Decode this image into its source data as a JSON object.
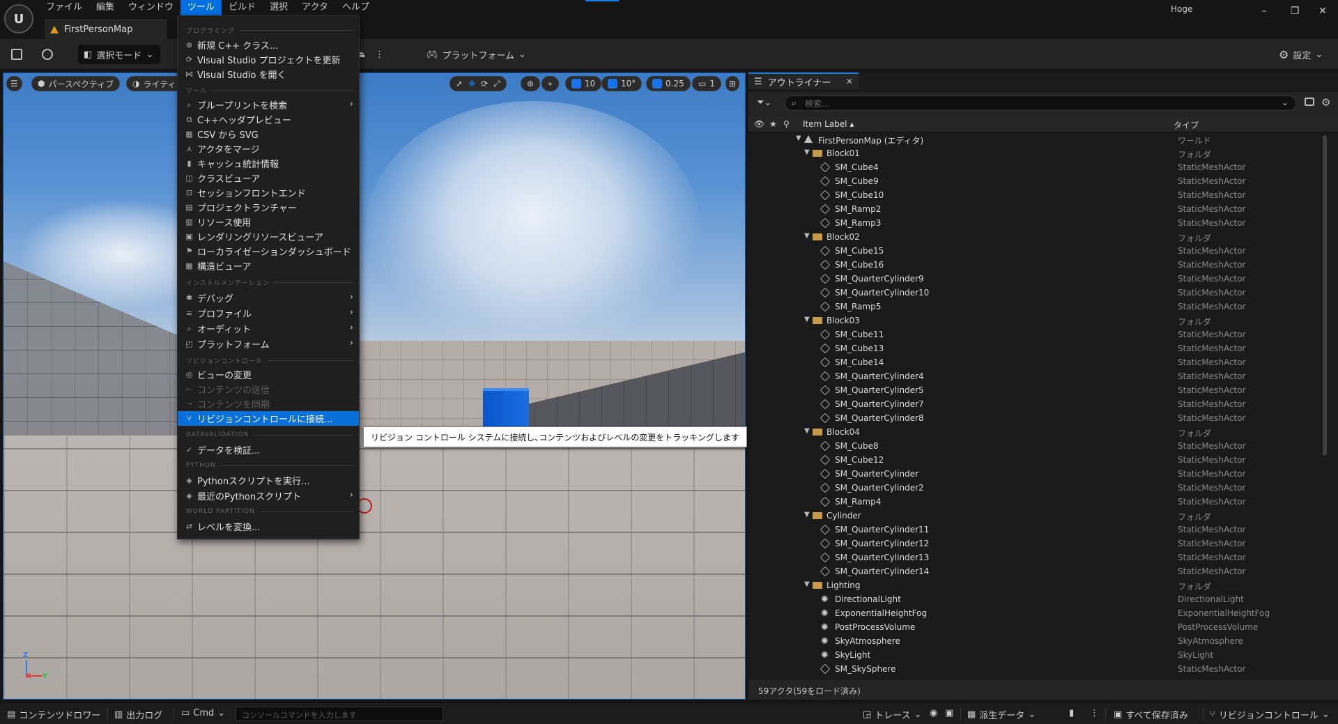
{
  "menubar": {
    "items": [
      "ファイル",
      "編集",
      "ウィンドウ",
      "ツール",
      "ビルド",
      "選択",
      "アクタ",
      "ヘルプ"
    ],
    "active_index": 3
  },
  "level_tab": "FirstPersonMap",
  "user_name": "Hoge",
  "toolbar": {
    "mode_label": "選択モード",
    "platform_label": "プラットフォーム",
    "settings_label": "設定"
  },
  "viewport": {
    "perspective_label": "パースペクティブ",
    "lighting_label": "ライティ",
    "grid_size": "10",
    "rotation_snap": "10°",
    "scale_snap": "0.25",
    "camera_speed": "1",
    "axis_labels": {
      "x": "X",
      "y": "Y",
      "z": "Z"
    },
    "accent_color": "#1a73e8"
  },
  "tools_menu": {
    "sections": {
      "programming": "プログラミング",
      "tools": "ツール",
      "instrumentation": "インストルメンテーション",
      "revision": "リビジョンコントロール",
      "datavalidation": "DATAVALIDATION",
      "python": "PYTHON",
      "world_partition": "WORLD PARTITION"
    },
    "items": {
      "new_cpp_class": "新規 C++ クラス...",
      "refresh_vs": "Visual Studio プロジェクトを更新",
      "open_vs": "Visual Studio を開く",
      "find_blueprint": "ブループリントを検索",
      "cpp_header_preview": "C++ヘッダプレビュー",
      "csv_to_svg": "CSV から SVG",
      "merge_actors": "アクタをマージ",
      "cache_stats": "キャッシュ統計情報",
      "class_viewer": "クラスビューア",
      "session_frontend": "セッションフロントエンド",
      "project_launcher": "プロジェクトランチャー",
      "resource_usage": "リソース使用",
      "render_resource_viewer": "レンダリングリソースビューア",
      "localization_dashboard": "ローカライゼーションダッシュボード",
      "struct_viewer": "構造ビューア",
      "debug": "デバッグ",
      "profile": "プロファイル",
      "audit": "オーディット",
      "platform": "プラットフォーム",
      "view_changes": "ビューの変更",
      "submit_content": "コンテンツの送信",
      "sync_content": "コンテンツを同期",
      "connect_revision": "リビジョンコントロールに接続...",
      "validate_data": "データを検証...",
      "run_python": "Pythonスクリプトを実行...",
      "recent_python": "最近のPythonスクリプト",
      "convert_level": "レベルを変換..."
    }
  },
  "tooltip": "リビジョン コントロール システムに接続し､コンテンツおよびレベルの変更をトラッキングします",
  "outliner": {
    "tab_title": "アウトライナー",
    "search_placeholder": "検索...",
    "col_label": "Item Label ▴",
    "col_type": "タイプ",
    "footer": "59アクタ(59をロード済み)",
    "rows": [
      {
        "label": "FirstPersonMap (エディタ)",
        "type": "ワールド",
        "kind": "world",
        "depth": 0
      },
      {
        "label": "Block01",
        "type": "フォルダ",
        "kind": "folder",
        "depth": 1
      },
      {
        "label": "SM_Cube4",
        "type": "StaticMeshActor",
        "kind": "mesh",
        "depth": 2
      },
      {
        "label": "SM_Cube9",
        "type": "StaticMeshActor",
        "kind": "mesh",
        "depth": 2
      },
      {
        "label": "SM_Cube10",
        "type": "StaticMeshActor",
        "kind": "mesh",
        "depth": 2
      },
      {
        "label": "SM_Ramp2",
        "type": "StaticMeshActor",
        "kind": "mesh",
        "depth": 2
      },
      {
        "label": "SM_Ramp3",
        "type": "StaticMeshActor",
        "kind": "mesh",
        "depth": 2
      },
      {
        "label": "Block02",
        "type": "フォルダ",
        "kind": "folder",
        "depth": 1
      },
      {
        "label": "SM_Cube15",
        "type": "StaticMeshActor",
        "kind": "mesh",
        "depth": 2
      },
      {
        "label": "SM_Cube16",
        "type": "StaticMeshActor",
        "kind": "mesh",
        "depth": 2
      },
      {
        "label": "SM_QuarterCylinder9",
        "type": "StaticMeshActor",
        "kind": "mesh",
        "depth": 2
      },
      {
        "label": "SM_QuarterCylinder10",
        "type": "StaticMeshActor",
        "kind": "mesh",
        "depth": 2
      },
      {
        "label": "SM_Ramp5",
        "type": "StaticMeshActor",
        "kind": "mesh",
        "depth": 2
      },
      {
        "label": "Block03",
        "type": "フォルダ",
        "kind": "folder",
        "depth": 1
      },
      {
        "label": "SM_Cube11",
        "type": "StaticMeshActor",
        "kind": "mesh",
        "depth": 2
      },
      {
        "label": "SM_Cube13",
        "type": "StaticMeshActor",
        "kind": "mesh",
        "depth": 2
      },
      {
        "label": "SM_Cube14",
        "type": "StaticMeshActor",
        "kind": "mesh",
        "depth": 2
      },
      {
        "label": "SM_QuarterCylinder4",
        "type": "StaticMeshActor",
        "kind": "mesh",
        "depth": 2
      },
      {
        "label": "SM_QuarterCylinder5",
        "type": "StaticMeshActor",
        "kind": "mesh",
        "depth": 2
      },
      {
        "label": "SM_QuarterCylinder7",
        "type": "StaticMeshActor",
        "kind": "mesh",
        "depth": 2
      },
      {
        "label": "SM_QuarterCylinder8",
        "type": "StaticMeshActor",
        "kind": "mesh",
        "depth": 2
      },
      {
        "label": "Block04",
        "type": "フォルダ",
        "kind": "folder",
        "depth": 1
      },
      {
        "label": "SM_Cube8",
        "type": "StaticMeshActor",
        "kind": "mesh",
        "depth": 2
      },
      {
        "label": "SM_Cube12",
        "type": "StaticMeshActor",
        "kind": "mesh",
        "depth": 2
      },
      {
        "label": "SM_QuarterCylinder",
        "type": "StaticMeshActor",
        "kind": "mesh",
        "depth": 2
      },
      {
        "label": "SM_QuarterCylinder2",
        "type": "StaticMeshActor",
        "kind": "mesh",
        "depth": 2
      },
      {
        "label": "SM_Ramp4",
        "type": "StaticMeshActor",
        "kind": "mesh",
        "depth": 2
      },
      {
        "label": "Cylinder",
        "type": "フォルダ",
        "kind": "folder",
        "depth": 1
      },
      {
        "label": "SM_QuarterCylinder11",
        "type": "StaticMeshActor",
        "kind": "mesh",
        "depth": 2
      },
      {
        "label": "SM_QuarterCylinder12",
        "type": "StaticMeshActor",
        "kind": "mesh",
        "depth": 2
      },
      {
        "label": "SM_QuarterCylinder13",
        "type": "StaticMeshActor",
        "kind": "mesh",
        "depth": 2
      },
      {
        "label": "SM_QuarterCylinder14",
        "type": "StaticMeshActor",
        "kind": "mesh",
        "depth": 2
      },
      {
        "label": "Lighting",
        "type": "フォルダ",
        "kind": "folder",
        "depth": 1
      },
      {
        "label": "DirectionalLight",
        "type": "DirectionalLight",
        "kind": "light",
        "depth": 2
      },
      {
        "label": "ExponentialHeightFog",
        "type": "ExponentialHeightFog",
        "kind": "light",
        "depth": 2
      },
      {
        "label": "PostProcessVolume",
        "type": "PostProcessVolume",
        "kind": "light",
        "depth": 2
      },
      {
        "label": "SkyAtmosphere",
        "type": "SkyAtmosphere",
        "kind": "light",
        "depth": 2
      },
      {
        "label": "SkyLight",
        "type": "SkyLight",
        "kind": "light",
        "depth": 2
      },
      {
        "label": "SM_SkySphere",
        "type": "StaticMeshActor",
        "kind": "mesh",
        "depth": 2
      }
    ]
  },
  "statusbar": {
    "content_drawer": "コンテンツドロワー",
    "output_log": "出力ログ",
    "cmd": "Cmd",
    "console_placeholder": "コンソールコマンドを入力します",
    "trace": "トレース",
    "derived_data": "派生データ",
    "save_all": "すべて保存済み",
    "revision_control": "リビジョンコントロール"
  }
}
